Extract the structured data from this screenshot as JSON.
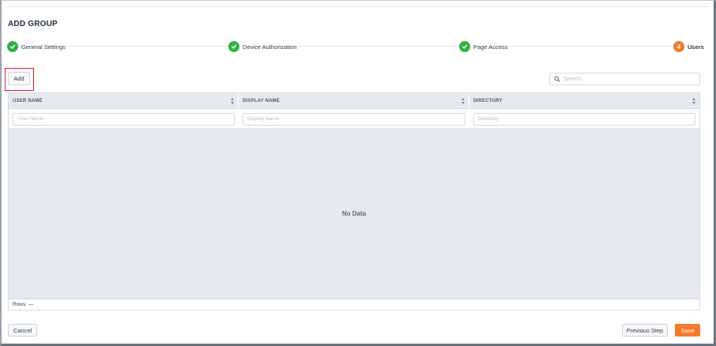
{
  "page": {
    "title": "ADD GROUP"
  },
  "stepper": {
    "steps": [
      {
        "label": "General Settings",
        "state": "done",
        "number": ""
      },
      {
        "label": "Device Authorization",
        "state": "done",
        "number": ""
      },
      {
        "label": "Page Access",
        "state": "done",
        "number": ""
      },
      {
        "label": "Users",
        "state": "active",
        "number": "4"
      }
    ],
    "done_icon": "check-icon"
  },
  "toolbar": {
    "add_label": "Add",
    "search_placeholder": "Search..."
  },
  "grid": {
    "columns": [
      {
        "header": "USER NAME",
        "filter_placeholder": "User Name"
      },
      {
        "header": "DISPLAY NAME",
        "filter_placeholder": "Display Name"
      },
      {
        "header": "DIRECTORY",
        "filter_placeholder": "Directory"
      }
    ],
    "empty_text": "No Data",
    "rows_text": "Rows: —"
  },
  "footer": {
    "cancel_label": "Cancel",
    "previous_label": "Previous Step",
    "save_label": "Save"
  },
  "colors": {
    "done": "#2fb343",
    "active": "#f37a2e",
    "highlight": "#e01e26"
  }
}
